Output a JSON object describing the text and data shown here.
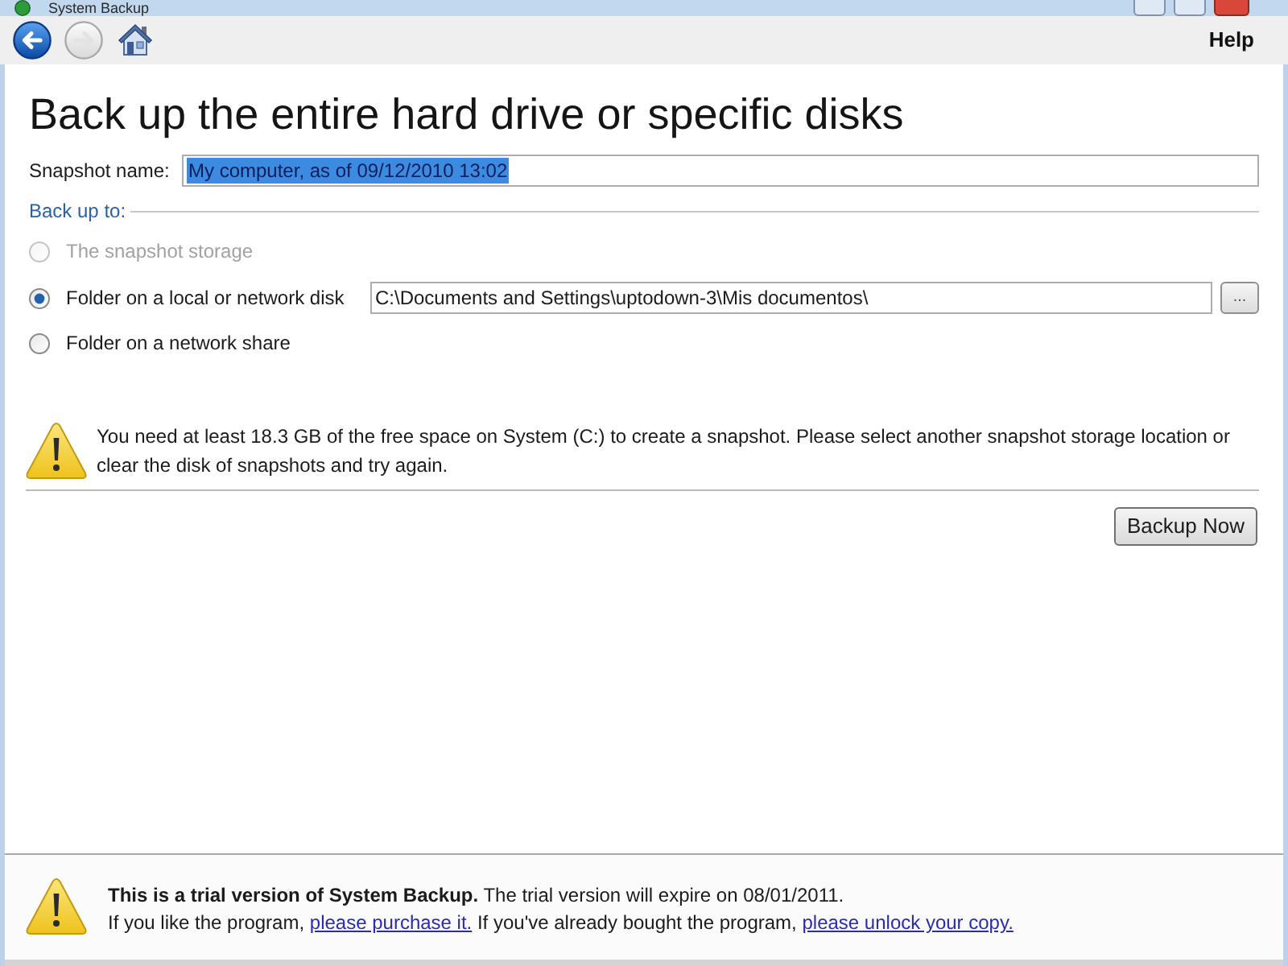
{
  "window": {
    "title": "System Backup"
  },
  "toolbar": {
    "buttons": [
      {
        "kind": "back",
        "disabled": false
      },
      {
        "kind": "forward",
        "disabled": true
      },
      {
        "kind": "home",
        "disabled": false
      }
    ],
    "help": "Help"
  },
  "heading": "Back up the entire hard drive or specific disks",
  "snapshot_name": {
    "label": "Snapshot name:",
    "value": "My computer, as of 09/12/2010 13:02",
    "selected": true
  },
  "back_up_to": {
    "label": "Back up to:",
    "options": [
      {
        "label": "The snapshot storage",
        "selected": false,
        "disabled": true
      },
      {
        "label": "Folder on a local or network disk",
        "selected": true,
        "disabled": false,
        "path": "C:\\Documents and Settings\\uptodown-3\\Mis documentos\\",
        "browse": "..."
      },
      {
        "label": "Folder on a network share",
        "selected": false,
        "disabled": false
      }
    ]
  },
  "warning": {
    "message": "You need at least 18.3 GB of the free space on System (C:) to create a snapshot. Please select another snapshot storage location or clear the disk of snapshots and try again."
  },
  "backup_button": "Backup Now",
  "trial_notice": {
    "headline": "**This is a trial version of System Backup.** The trial version will expire on 08/01/2011.",
    "message": [
      {
        "kind": "text",
        "text": "If you like the program,"
      },
      {
        "kind": "link",
        "text": "please purchase it."
      },
      {
        "kind": "text",
        "text": "If you've already bought the program,"
      },
      {
        "kind": "link",
        "text": "please unlock your copy."
      }
    ]
  }
}
